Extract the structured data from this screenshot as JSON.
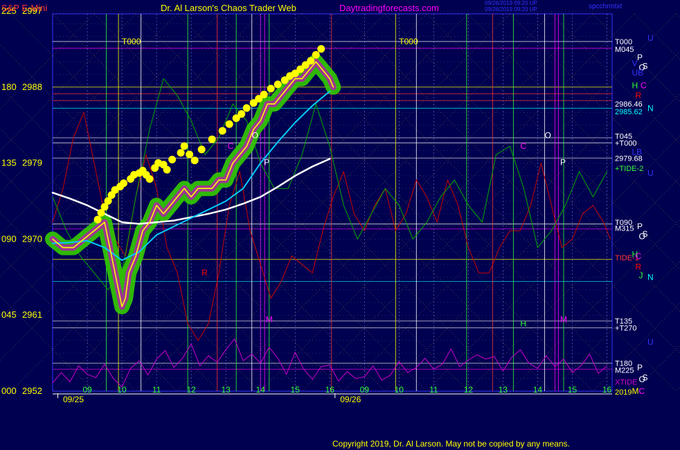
{
  "header": {
    "left_title": "S&P E-Mini",
    "center_title": "Dr. Al Larson's Chaos Trader Web",
    "site": "Daytradingforecasts.com",
    "stamp1": "09/26/2019 09:20 UP",
    "stamp2": "09/26/2019 09:20 UP",
    "file": "spcchrmtxt"
  },
  "copyright": "Copyright 2019, Dr. Al Larson. May not be copied by any means.",
  "colors": {
    "background": "#000050",
    "price": "#ffff00",
    "glow": "#33cc00",
    "avg_fast": "#00ccff",
    "avg_slow": "#ffffff",
    "tide_red": "#cc0000",
    "tide_green": "#00aa00",
    "xtide": "#cc00cc"
  },
  "chart_data": {
    "type": "line",
    "title": "S&P E-Mini",
    "ylim": [
      2952,
      2997
    ],
    "y_ticks": [
      {
        "angle": "225",
        "price": "2997",
        "value": 2997
      },
      {
        "angle": "180",
        "price": "2988",
        "value": 2988
      },
      {
        "angle": "135",
        "price": "2979",
        "value": 2979
      },
      {
        "angle": "090",
        "price": "2970",
        "value": 2970
      },
      {
        "angle": "045",
        "price": "2961",
        "value": 2961
      },
      {
        "angle": "000",
        "price": "2952",
        "value": 2952
      }
    ],
    "x_hours": [
      {
        "label": "09",
        "x": 4
      },
      {
        "label": "10",
        "x": 5
      },
      {
        "label": "11",
        "x": 6
      },
      {
        "label": "12",
        "x": 7
      },
      {
        "label": "13",
        "x": 8
      },
      {
        "label": "14",
        "x": 9
      },
      {
        "label": "15",
        "x": 10
      },
      {
        "label": "16",
        "x": 11
      },
      {
        "label": "09",
        "x": 12
      },
      {
        "label": "10",
        "x": 13
      },
      {
        "label": "11",
        "x": 14
      },
      {
        "label": "12",
        "x": 15
      },
      {
        "label": "13",
        "x": 16
      },
      {
        "label": "14",
        "x": 17
      },
      {
        "label": "15",
        "x": 18
      },
      {
        "label": "16",
        "x": 19
      }
    ],
    "xlim": [
      3.0,
      19.15
    ],
    "date_labels": [
      {
        "label": "09/25",
        "x": 3.6
      },
      {
        "label": "09/26",
        "x": 11.6
      }
    ],
    "price_series": {
      "name": "S&P E-Mini",
      "x": [
        3.0,
        3.3,
        3.6,
        3.9,
        4.2,
        4.5,
        4.7,
        4.9,
        5.0,
        5.1,
        5.2,
        5.4,
        5.6,
        5.8,
        6.0,
        6.2,
        6.4,
        6.6,
        6.8,
        7.0,
        7.2,
        7.4,
        7.6,
        7.8,
        8.0,
        8.2,
        8.4,
        8.6,
        8.8,
        9.0,
        9.2,
        9.4,
        9.6,
        9.8,
        10.0,
        10.2,
        10.4,
        10.6,
        10.8,
        11.0,
        11.1
      ],
      "y": [
        2970,
        2969,
        2969,
        2970,
        2971,
        2972,
        2968,
        2964,
        2962,
        2963,
        2966,
        2968,
        2971,
        2972,
        2974,
        2973,
        2974,
        2975,
        2976,
        2975,
        2976,
        2976,
        2976,
        2977,
        2977,
        2979,
        2980,
        2981,
        2983,
        2984,
        2986,
        2986,
        2987,
        2988,
        2989,
        2989,
        2990,
        2991,
        2990,
        2989,
        2988
      ]
    },
    "avg_fast": {
      "name": "",
      "x": [
        3.0,
        3.5,
        4.0,
        4.5,
        5.0,
        5.5,
        6.0,
        6.5,
        7.0,
        7.5,
        8.0,
        8.5,
        9.0,
        9.5,
        10.0,
        10.5,
        11.0
      ],
      "y": [
        2969.5,
        2969.6,
        2969.8,
        2969.0,
        2967.5,
        2968.5,
        2970.5,
        2971.5,
        2972.5,
        2973.5,
        2974.5,
        2976.0,
        2979.0,
        2981.5,
        2983.8,
        2985.8,
        2987.5
      ]
    },
    "avg_slow": {
      "name": "",
      "x": [
        3.0,
        3.5,
        4.0,
        4.5,
        5.0,
        5.5,
        6.0,
        6.5,
        7.0,
        7.5,
        8.0,
        8.5,
        9.0,
        9.5,
        10.0,
        10.5,
        11.0
      ],
      "y": [
        2975.5,
        2974.8,
        2974.0,
        2973.0,
        2972.0,
        2971.8,
        2972.0,
        2972.2,
        2972.6,
        2973.0,
        2973.5,
        2974.2,
        2975.0,
        2976.2,
        2977.5,
        2978.6,
        2979.5
      ]
    },
    "red_tide": {
      "name": "TIDE-1",
      "x": [
        3.0,
        3.3,
        3.6,
        3.9,
        4.2,
        4.5,
        4.8,
        5.1,
        5.4,
        5.7,
        6.0,
        6.3,
        6.6,
        6.9,
        7.2,
        7.5,
        7.8,
        8.1,
        8.4,
        8.7,
        9.0,
        9.3,
        9.6,
        9.9,
        10.2,
        10.5,
        10.8,
        11.1,
        11.4,
        11.7,
        12.0,
        12.3,
        12.6,
        12.9,
        13.2,
        13.5,
        13.8,
        14.1,
        14.4,
        14.7,
        15.0,
        15.3,
        15.6,
        15.9,
        16.2,
        16.5,
        16.8,
        17.1,
        17.4,
        17.7,
        18.0,
        18.3,
        18.6,
        18.9,
        19.1
      ],
      "y": [
        2972,
        2976,
        2982,
        2985,
        2979,
        2973,
        2970,
        2968,
        2975,
        2980,
        2976,
        2969,
        2966,
        2960,
        2958,
        2960,
        2966,
        2974,
        2978,
        2971,
        2967,
        2963,
        2965,
        2968,
        2967,
        2966,
        2971,
        2975,
        2978,
        2973,
        2971,
        2974,
        2976,
        2971,
        2973,
        2977,
        2975,
        2972,
        2977,
        2974,
        2969,
        2966,
        2966,
        2969,
        2971,
        2971,
        2974,
        2979,
        2974,
        2969,
        2970,
        2973,
        2974,
        2972,
        2970
      ]
    },
    "green_tide": {
      "name": "TIDE-2",
      "x": [
        3.0,
        3.4,
        3.8,
        4.2,
        4.6,
        5.0,
        5.4,
        5.8,
        6.2,
        6.6,
        7.0,
        7.4,
        7.8,
        8.2,
        8.6,
        9.0,
        9.4,
        9.8,
        10.2,
        10.6,
        11.0,
        11.4,
        11.8,
        12.2,
        12.6,
        13.0,
        13.4,
        13.8,
        14.2,
        14.6,
        15.0,
        15.4,
        15.8,
        16.2,
        16.6,
        17.0,
        17.4,
        17.8,
        18.2,
        18.6,
        19.0
      ],
      "y": [
        2975,
        2971,
        2968,
        2966,
        2964,
        2966,
        2975,
        2983,
        2989,
        2987,
        2984,
        2980,
        2982,
        2986,
        2984,
        2979,
        2976,
        2976,
        2980,
        2986,
        2981,
        2974,
        2970,
        2973,
        2976,
        2974,
        2970,
        2972,
        2975,
        2977,
        2974,
        2972,
        2980,
        2981,
        2976,
        2969,
        2971,
        2974,
        2978,
        2975,
        2978
      ]
    },
    "xtide": {
      "name": "XTIDE",
      "x": [
        3.0,
        3.25,
        3.5,
        3.75,
        4.0,
        4.25,
        4.5,
        4.75,
        5.0,
        5.25,
        5.5,
        5.75,
        6.0,
        6.25,
        6.5,
        6.75,
        7.0,
        7.25,
        7.5,
        7.75,
        8.0,
        8.25,
        8.5,
        8.75,
        9.0,
        9.25,
        9.5,
        9.75,
        10.0,
        10.25,
        10.5,
        10.75,
        11.0,
        11.25,
        11.5,
        11.75,
        12.0,
        12.25,
        12.5,
        12.75,
        13.0,
        13.25,
        13.5,
        13.75,
        14.0,
        14.25,
        14.5,
        14.75,
        15.0,
        15.25,
        15.5,
        15.75,
        16.0,
        16.25,
        16.5,
        16.75,
        17.0,
        17.25,
        17.5,
        17.75,
        18.0,
        18.25,
        18.5,
        18.75,
        19.0
      ],
      "y": [
        2953.0,
        2954.2,
        2953.1,
        2955.0,
        2954.0,
        2953.6,
        2955.2,
        2953.5,
        2952.5,
        2954.7,
        2955.6,
        2953.9,
        2955.8,
        2956.8,
        2954.8,
        2955.9,
        2957.6,
        2955.0,
        2956.2,
        2955.4,
        2956.9,
        2958.2,
        2955.6,
        2956.4,
        2955.3,
        2957.2,
        2955.9,
        2954.0,
        2956.6,
        2954.6,
        2953.4,
        2954.9,
        2955.1,
        2953.2,
        2954.3,
        2953.5,
        2953.7,
        2955.0,
        2953.3,
        2953.9,
        2955.5,
        2954.2,
        2954.8,
        2955.9,
        2954.6,
        2955.2,
        2957.0,
        2954.9,
        2955.7,
        2956.3,
        2955.8,
        2956.1,
        2954.4,
        2956.0,
        2956.9,
        2955.3,
        2954.7,
        2956.2,
        2954.9,
        2955.8,
        2954.2,
        2955.0,
        2956.4,
        2954.1,
        2955.0
      ]
    },
    "yellow_dots": {
      "x": [
        4.3,
        4.4,
        4.5,
        4.6,
        4.7,
        4.8,
        4.95,
        5.05,
        5.25,
        5.35,
        5.5,
        5.6,
        5.7,
        5.8,
        5.95,
        6.05,
        6.2,
        6.3,
        6.45,
        6.7,
        6.8,
        6.95,
        7.1,
        7.3,
        7.6,
        7.9,
        8.1,
        8.3,
        8.45,
        8.6,
        8.8,
        8.95,
        9.1,
        9.3,
        9.5,
        9.7,
        9.85,
        10.0,
        10.15,
        10.3,
        10.45,
        10.6,
        10.75
      ],
      "y": [
        2971.5,
        2972.3,
        2973.0,
        2973.7,
        2974.4,
        2975.0,
        2975.4,
        2975.8,
        2976.3,
        2976.8,
        2977.0,
        2977.3,
        2976.8,
        2976.3,
        2977.6,
        2978.2,
        2978.0,
        2977.4,
        2978.6,
        2979.4,
        2980.2,
        2979.2,
        2978.5,
        2979.8,
        2981.0,
        2982.0,
        2982.8,
        2983.5,
        2984.0,
        2984.7,
        2985.3,
        2985.8,
        2986.3,
        2987.0,
        2987.5,
        2988.0,
        2988.5,
        2988.8,
        2989.3,
        2989.8,
        2990.3,
        2991.0,
        2991.7
      ]
    },
    "level_labels": [
      {
        "text": "T000",
        "side": "right",
        "y": 2993.4,
        "color": "#ffffff"
      },
      {
        "text": "M045",
        "side": "right",
        "y": 2992.5,
        "color": "#ffffff"
      },
      {
        "text": "T045",
        "side": "right",
        "y": 2982.2,
        "color": "#ffffff"
      },
      {
        "text": "+T000",
        "side": "right",
        "y": 2981.4,
        "color": "#ffffff"
      },
      {
        "text": "2979.68",
        "side": "right",
        "y": 2979.6,
        "color": "#ffffff"
      },
      {
        "text": "+TIDE-2",
        "side": "right",
        "y": 2978.4,
        "color": "#33ff33"
      },
      {
        "text": "T090",
        "side": "right",
        "y": 2972.0,
        "color": "#ffffff"
      },
      {
        "text": "M315",
        "side": "right",
        "y": 2971.3,
        "color": "#ffffff"
      },
      {
        "text": "TIDE-1",
        "side": "right",
        "y": 2967.8,
        "color": "#ff3333"
      },
      {
        "text": "T135",
        "side": "right",
        "y": 2960.3,
        "color": "#ffffff"
      },
      {
        "text": "+T270",
        "side": "right",
        "y": 2959.5,
        "color": "#ffffff"
      },
      {
        "text": "T180",
        "side": "right",
        "y": 2955.3,
        "color": "#ffffff"
      },
      {
        "text": "M225",
        "side": "right",
        "y": 2954.5,
        "color": "#ffffff"
      },
      {
        "text": "XTIDE",
        "side": "right",
        "y": 2953.1,
        "color": "#cc00cc"
      },
      {
        "text": "2019",
        "side": "right",
        "y": 2951.9,
        "color": "#ffff00"
      },
      {
        "text": "2986.46",
        "side": "right",
        "y": 2986.0,
        "color": "#ffffff"
      },
      {
        "text": "2985.62",
        "side": "right",
        "y": 2985.1,
        "color": "#00ffff"
      }
    ],
    "planet_letters": [
      {
        "text": "U",
        "x": 19.65,
        "y": 2993.8,
        "color": "#3333ff"
      },
      {
        "text": "P",
        "x": 19.35,
        "y": 2991.5,
        "color": "#ffffff"
      },
      {
        "text": "O",
        "x": 19.4,
        "y": 2990.3,
        "color": "#ffffff"
      },
      {
        "text": "S",
        "x": 19.5,
        "y": 2990.5,
        "color": "#ffffff"
      },
      {
        "text": "V",
        "x": 19.2,
        "y": 2990.8,
        "color": "#3333ff"
      },
      {
        "text": "UB",
        "x": 19.2,
        "y": 2989.7,
        "color": "#3333ff"
      },
      {
        "text": "H",
        "x": 19.2,
        "y": 2988.2,
        "color": "#33ff33"
      },
      {
        "text": "C",
        "x": 19.45,
        "y": 2988.2,
        "color": "#ff00ff"
      },
      {
        "text": "R",
        "x": 19.3,
        "y": 2987.0,
        "color": "#ff0000"
      },
      {
        "text": "N",
        "x": 19.65,
        "y": 2985.5,
        "color": "#00ffff"
      },
      {
        "text": "LB",
        "x": 19.2,
        "y": 2980.3,
        "color": "#3333ff"
      },
      {
        "text": "U",
        "x": 19.65,
        "y": 2977.8,
        "color": "#3333ff"
      },
      {
        "text": "P",
        "x": 19.35,
        "y": 2971.5,
        "color": "#ffffff"
      },
      {
        "text": "O",
        "x": 19.4,
        "y": 2970.3,
        "color": "#ffffff"
      },
      {
        "text": "S",
        "x": 19.5,
        "y": 2970.6,
        "color": "#ffffff"
      },
      {
        "text": "H",
        "x": 19.2,
        "y": 2968.2,
        "color": "#33ff33"
      },
      {
        "text": "C",
        "x": 19.3,
        "y": 2968.0,
        "color": "#ff00ff"
      },
      {
        "text": "R",
        "x": 19.3,
        "y": 2966.7,
        "color": "#ff0000"
      },
      {
        "text": "J",
        "x": 19.4,
        "y": 2965.7,
        "color": "#33ff33"
      },
      {
        "text": "N",
        "x": 19.65,
        "y": 2965.5,
        "color": "#00ffff"
      },
      {
        "text": "U",
        "x": 19.65,
        "y": 2957.8,
        "color": "#3333ff"
      },
      {
        "text": "P",
        "x": 19.35,
        "y": 2954.8,
        "color": "#ffffff"
      },
      {
        "text": "O",
        "x": 19.4,
        "y": 2953.4,
        "color": "#ffffff"
      },
      {
        "text": "S",
        "x": 19.5,
        "y": 2953.6,
        "color": "#ffffff"
      },
      {
        "text": "M",
        "x": 19.2,
        "y": 2952.0,
        "color": "#ffff00"
      },
      {
        "text": "C",
        "x": 19.4,
        "y": 2952.0,
        "color": "#ff00ff"
      }
    ],
    "chart_notes": [
      {
        "text": "T000",
        "x": 5.0,
        "y": 2993.4,
        "color": "#ffff00"
      },
      {
        "text": "T000",
        "x": 13.0,
        "y": 2993.4,
        "color": "#ffff00"
      },
      {
        "text": "O",
        "x": 8.75,
        "y": 2982.3,
        "color": "#ffffff"
      },
      {
        "text": "P",
        "x": 9.1,
        "y": 2979.1,
        "color": "#ffffff"
      },
      {
        "text": "O",
        "x": 17.2,
        "y": 2982.3,
        "color": "#ffffff"
      },
      {
        "text": "P",
        "x": 17.65,
        "y": 2979.1,
        "color": "#ffffff"
      },
      {
        "text": "C",
        "x": 8.05,
        "y": 2981.0,
        "color": "#ff00ff"
      },
      {
        "text": "C",
        "x": 16.5,
        "y": 2981.0,
        "color": "#ff00ff"
      },
      {
        "text": "R",
        "x": 7.3,
        "y": 2966.0,
        "color": "#ff0000"
      },
      {
        "text": "H",
        "x": 16.5,
        "y": 2960.0,
        "color": "#33ff33"
      },
      {
        "text": "M",
        "x": 9.15,
        "y": 2960.5,
        "color": "#ff00ff"
      },
      {
        "text": "M",
        "x": 17.65,
        "y": 2960.5,
        "color": "#ff00ff"
      }
    ],
    "v_lines": [
      {
        "x": 4.55,
        "color": "#33ff33"
      },
      {
        "x": 4.9,
        "color": "#ffff00"
      },
      {
        "x": 5.55,
        "color": "#ffffff"
      },
      {
        "x": 6.9,
        "color": "#33ff33"
      },
      {
        "x": 7.75,
        "color": "#ff3333"
      },
      {
        "x": 8.3,
        "color": "#33ff33"
      },
      {
        "x": 8.75,
        "color": "#ffffff"
      },
      {
        "x": 9.0,
        "color": "#ff00ff"
      },
      {
        "x": 9.12,
        "color": "#ff00ff"
      },
      {
        "x": 9.25,
        "color": "#33ff33"
      },
      {
        "x": 11.05,
        "color": "#ff3333"
      },
      {
        "x": 12.9,
        "color": "#ffff00"
      },
      {
        "x": 13.5,
        "color": "#ffffff"
      },
      {
        "x": 14.95,
        "color": "#33ff33"
      },
      {
        "x": 15.7,
        "color": "#ff3333"
      },
      {
        "x": 16.3,
        "color": "#33ff33"
      },
      {
        "x": 17.2,
        "color": "#ffffff"
      },
      {
        "x": 17.5,
        "color": "#ff00ff"
      },
      {
        "x": 17.6,
        "color": "#ff00ff"
      },
      {
        "x": 17.75,
        "color": "#33ff33"
      }
    ],
    "h_levels": [
      {
        "y": 2993.4,
        "color": "#ffffff"
      },
      {
        "y": 2992.6,
        "color": "#ff00ff"
      },
      {
        "y": 2988.0,
        "color": "#ffff00"
      },
      {
        "y": 2987.2,
        "color": "#ff3333"
      },
      {
        "y": 2986.4,
        "color": "#ff3333"
      },
      {
        "y": 2985.5,
        "color": "#00ffff"
      },
      {
        "y": 2982.0,
        "color": "#ffffff"
      },
      {
        "y": 2981.4,
        "color": "#ffffff"
      },
      {
        "y": 2979.6,
        "color": "#ffffff"
      },
      {
        "y": 2971.8,
        "color": "#ffffff"
      },
      {
        "y": 2971.2,
        "color": "#ff00ff"
      },
      {
        "y": 2967.6,
        "color": "#ffff00"
      },
      {
        "y": 2965.0,
        "color": "#00ffff"
      },
      {
        "y": 2960.3,
        "color": "#ffffff"
      },
      {
        "y": 2959.5,
        "color": "#ffffff"
      },
      {
        "y": 2955.3,
        "color": "#ffffff"
      },
      {
        "y": 2954.6,
        "color": "#ff00ff"
      }
    ],
    "grid": true
  }
}
